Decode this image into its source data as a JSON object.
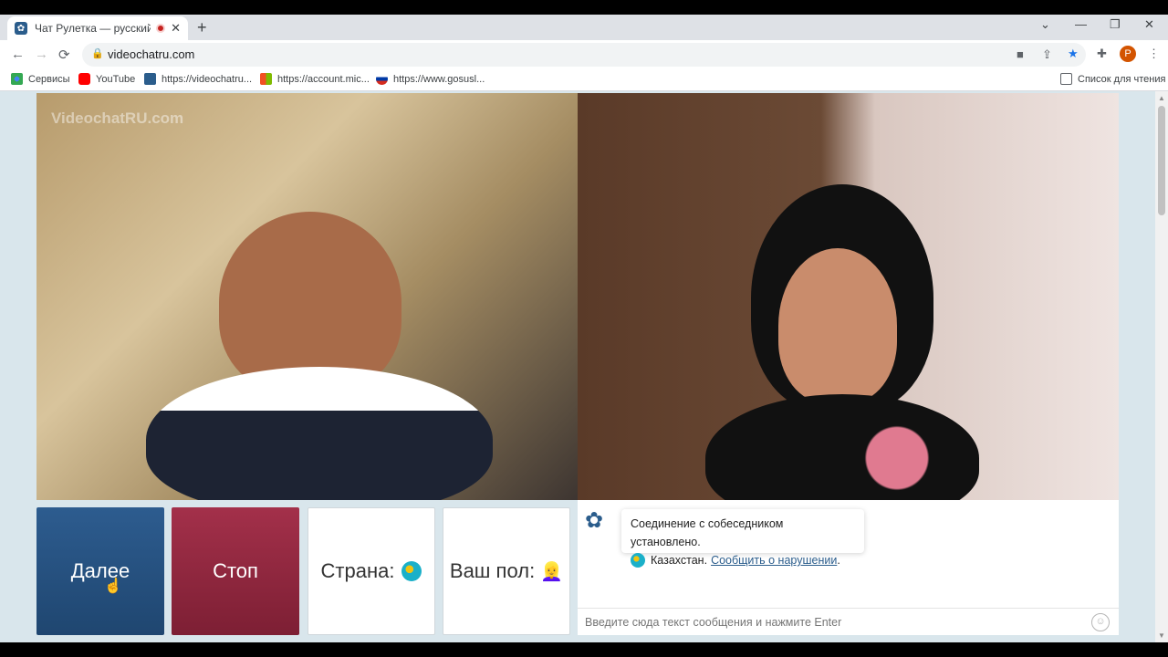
{
  "tab": {
    "title": "Чат Рулетка — русский вид",
    "close": "✕",
    "new_tab": "+"
  },
  "window_controls": {
    "menu": "⌄",
    "minimize": "—",
    "restore": "❐",
    "close": "✕"
  },
  "toolbar": {
    "back": "←",
    "forward": "→",
    "reload": "⟳",
    "lock": "🔒",
    "url": "videochatru.com",
    "avatar_letter": "P",
    "menu": "⋮"
  },
  "bookmarks": {
    "items": [
      {
        "label": "Сервисы",
        "color": "#4285f4"
      },
      {
        "label": "YouTube",
        "color": "#ff0000"
      },
      {
        "label": "https://videochatru...",
        "color": "#2b5d8c"
      },
      {
        "label": "https://account.mic...",
        "color": "#f25022"
      },
      {
        "label": "https://www.gosusl...",
        "color": "#d52b1e"
      }
    ],
    "reading_list": "Список для чтения"
  },
  "video": {
    "watermark": "VideochatRU.com"
  },
  "controls": {
    "next_label": "Далее",
    "stop_label": "Стоп",
    "country_label": "Страна:",
    "gender_label": "Ваш пол:",
    "gender_emoji": "👱‍♀️"
  },
  "chat": {
    "status_message": "Соединение с собеседником установлено.",
    "country_name": "Казахстан.",
    "report_link": "Сообщить о нарушении",
    "report_suffix": ".",
    "input_placeholder": "Введите сюда текст сообщения и нажмите Enter"
  },
  "colors": {
    "next_button": "#2d5c8f",
    "stop_button": "#a3304a",
    "page_background": "#d9e6ec",
    "link": "#2b5d8c"
  }
}
